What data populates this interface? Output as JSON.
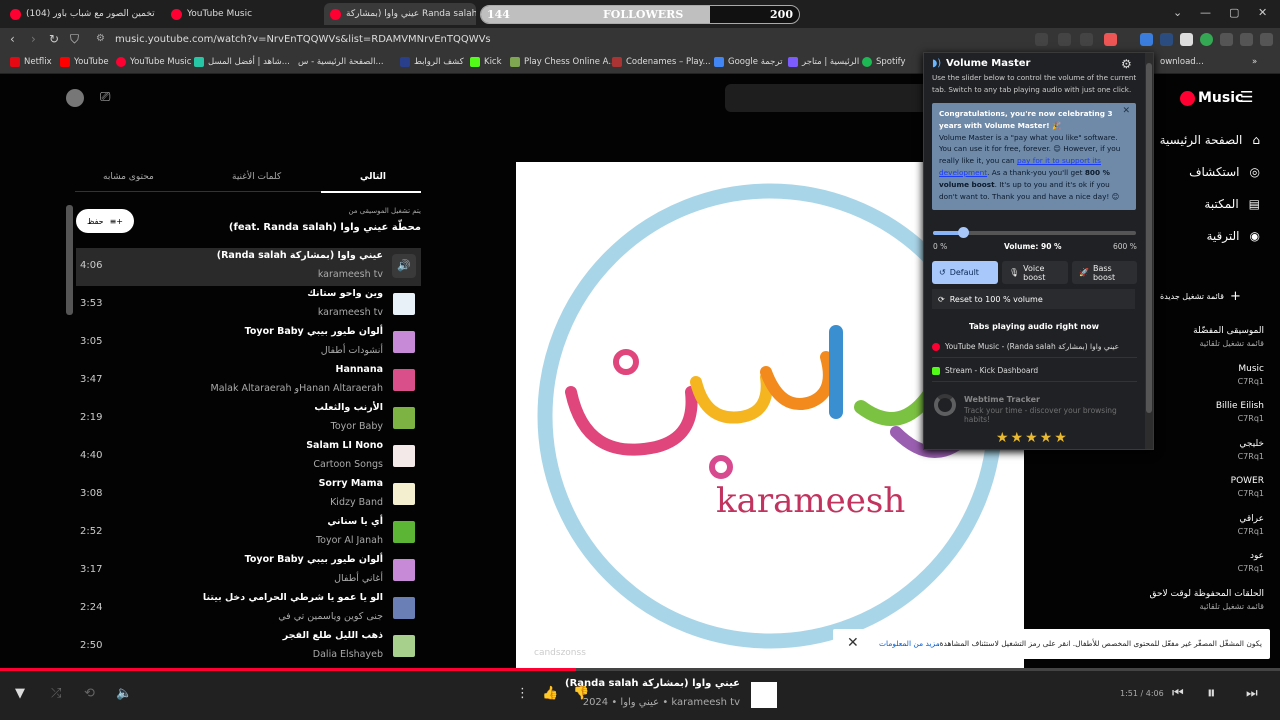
{
  "tabs": [
    {
      "label": "تخمين الصور مع شباب باور (104)"
    },
    {
      "label": "YouTube Music"
    },
    {
      "label": "عيني واوا (بمشاركة Randa salah"
    }
  ],
  "followers": {
    "left": "144",
    "label": "FOLLOWERS",
    "right": "200",
    "fill": 0.72
  },
  "address": {
    "url": "music.youtube.com/watch?v=NrvEnTQQWVs&list=RDAMVMNrvEnTQQWVs"
  },
  "bookmarks": [
    "Netflix",
    "YouTube",
    "YouTube Music",
    "شاهد | أفضل المسل...",
    "الصفحة الرئيسية - س...",
    "كشف الروابط",
    "Kick",
    "Play Chess Online A...",
    "Codenames – Play...",
    "Google ترجمة",
    "الرئيسية | متاجر",
    "Spotify",
    "ownload..."
  ],
  "ytm": {
    "search_placeholder": "وفنانين وبرامج بودكاست",
    "logo": "Music",
    "nav": [
      "الصفحة الرئيسية",
      "استكشاف",
      "المكتبة",
      "الترقية"
    ],
    "new_playlist": "قائمة تشغيل جديدة",
    "playlists": [
      {
        "t": "الموسيقى المفضّلة",
        "s": "قائمة تشغيل تلقائية"
      },
      {
        "t": "Music",
        "s": "C7Rq1"
      },
      {
        "t": "Billie Eilish",
        "s": "C7Rq1"
      },
      {
        "t": "خليجي",
        "s": "C7Rq1"
      },
      {
        "t": "POWER",
        "s": "C7Rq1"
      },
      {
        "t": "عراقي",
        "s": "C7Rq1"
      },
      {
        "t": "عود",
        "s": "C7Rq1"
      },
      {
        "t": "الحلقات المحفوظة لوقت لاحق",
        "s": "قائمة تشغيل تلقائية"
      }
    ]
  },
  "queue": {
    "tabs": [
      "التالي",
      "كلمات الأغنية",
      "محتوى مشابه"
    ],
    "save": "حفظ",
    "playing_from": "يتم تشغيل الموسيقى من",
    "station": "محطّة عيني واوا (feat. Randa salah)",
    "items": [
      {
        "title": "عيني واوا (بمشاركة Randa salah)",
        "artist": "karameesh tv",
        "duration": "4:06",
        "color": "#ffffff"
      },
      {
        "title": "وين واحو ستانك",
        "artist": "karameesh tv",
        "duration": "3:53",
        "color": "#e8f1f8"
      },
      {
        "title": "ألوان طيور بيبي Toyor Baby",
        "artist": "أنشودات أطفال",
        "duration": "3:05",
        "color": "#c78ad6"
      },
      {
        "title": "Hannana",
        "artist": "Hanan Altaraerahو Malak Altaraerah",
        "duration": "3:47",
        "color": "#d94f8a"
      },
      {
        "title": "الأرنب والثعلب",
        "artist": "Toyor Baby",
        "duration": "2:19",
        "color": "#7cb342"
      },
      {
        "title": "Salam LI Nono",
        "artist": "Cartoon Songs",
        "duration": "4:40",
        "color": "#f3e9e9"
      },
      {
        "title": "Sorry Mama",
        "artist": "Kidzy Band",
        "duration": "3:08",
        "color": "#f4f0cf"
      },
      {
        "title": "أي يا سناني",
        "artist": "Toyor Al Janah",
        "duration": "2:52",
        "color": "#5cb534"
      },
      {
        "title": "ألوان طيور بيبي Toyor Baby",
        "artist": "أغاني أطفال",
        "duration": "3:17",
        "color": "#c78ad6"
      },
      {
        "title": "الو يا عمو يا شرطي الحرامي دخل بيتنا",
        "artist": "جنى كوين وياسمين تي في",
        "duration": "2:24",
        "color": "#6a7fb6"
      },
      {
        "title": "ذهب الليل طلع الفجر",
        "artist": "Dalia Elshayeb",
        "duration": "2:50",
        "color": "#a8d08d"
      }
    ]
  },
  "album": {
    "logo_text": "karameesh",
    "watermark": "candszonss"
  },
  "notice": {
    "text": "يكون المشغّل المصغّر غير مفعّل للمحتوى المخصص للأطفال. انقر على رمز التشغيل لاستئناف المشاهدة.",
    "more": "مزيد من المعلومات"
  },
  "volume_master": {
    "title": "Volume Master",
    "desc": "Use the slider below to control the volume of the current tab. Switch to any tab playing audio with just one click.",
    "congrats_head": "Congratulations, you're now celebrating 3 years with Volume Master! 🎉",
    "congrats_p1": "Volume Master is a \"pay what you like\" software. You can use it for free, forever. 😊 However, if you really like it, you can",
    "congrats_link": "pay for it to support its development",
    "congrats_p2": ". As a thank-you you'll get",
    "congrats_bold": "800 % volume boost",
    "congrats_p3": ". It's up to you and it's ok if you don't want to. Thank you and have a nice day! 😊",
    "slider_min": "0 %",
    "slider_label": "Volume: 90 %",
    "slider_max": "600 %",
    "slider_value": 90,
    "slider_max_value": 600,
    "modes": [
      "Default",
      "Voice boost",
      "Bass boost"
    ],
    "reset": "Reset to 100 % volume",
    "tabs_heading": "Tabs playing audio right now",
    "audio_tabs": [
      "YouTube Music - (Randa salah بمشاركة) عيني واوا",
      "Stream - Kick Dashboard"
    ],
    "webtime_title": "Webtime Tracker",
    "webtime_sub": "Track your time - discover your browsing habits!",
    "stars": "★★★★★"
  },
  "player": {
    "title": "عيني واوا (بمشاركة Randa salah)",
    "subtitle": "karameesh tv • عيني واوا • 2024",
    "time": "1:51 / 4:06",
    "progress": 0.45
  }
}
